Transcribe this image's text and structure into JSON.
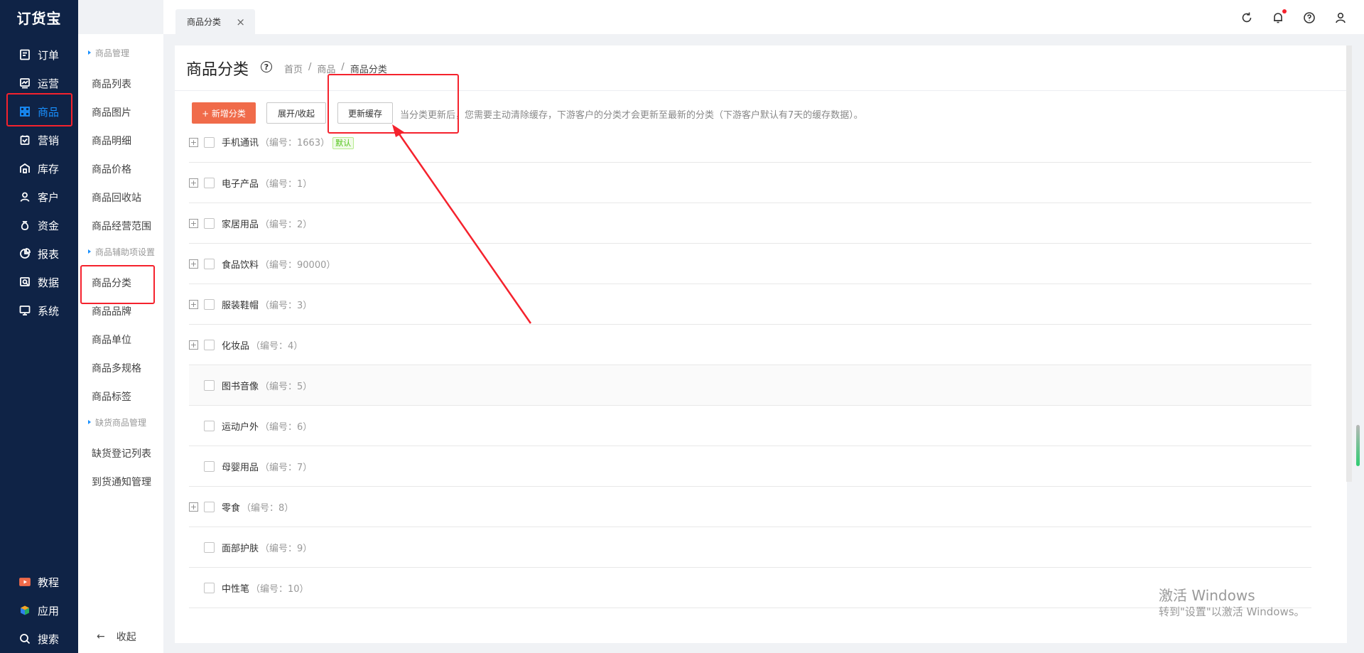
{
  "app": {
    "logo": "订货宝"
  },
  "nav": {
    "items": [
      {
        "label": "订单",
        "icon": "order-icon"
      },
      {
        "label": "运营",
        "icon": "operation-icon"
      },
      {
        "label": "商品",
        "icon": "product-icon",
        "active": true
      },
      {
        "label": "营销",
        "icon": "marketing-icon"
      },
      {
        "label": "库存",
        "icon": "warehouse-icon"
      },
      {
        "label": "客户",
        "icon": "user-icon"
      },
      {
        "label": "资金",
        "icon": "money-bag-icon"
      },
      {
        "label": "报表",
        "icon": "pie-chart-icon"
      },
      {
        "label": "数据",
        "icon": "data-icon"
      },
      {
        "label": "系统",
        "icon": "monitor-icon"
      }
    ],
    "bottom": [
      {
        "label": "教程",
        "icon": "video-icon"
      },
      {
        "label": "应用",
        "icon": "cube-icon"
      },
      {
        "label": "搜索",
        "icon": "search-icon"
      }
    ]
  },
  "submenu": {
    "group1": "商品管理",
    "group1_items": [
      "商品列表",
      "商品图片",
      "商品明细",
      "商品价格",
      "商品回收站",
      "商品经营范围"
    ],
    "group2": "商品辅助项设置",
    "group2_items": [
      "商品分类",
      "商品品牌",
      "商品单位",
      "商品多规格",
      "商品标签"
    ],
    "group3": "缺货商品管理",
    "group3_items": [
      "缺货登记列表",
      "到货通知管理"
    ],
    "collapse": "收起",
    "collapse_arrow": "←"
  },
  "tabs": [
    {
      "label": "商品分类",
      "close": "×"
    }
  ],
  "page": {
    "title": "商品分类",
    "help": "?",
    "breadcrumb": [
      "首页",
      "商品",
      "商品分类"
    ],
    "breadcrumb_sep": "/",
    "buttons": {
      "add": "+ 新增分类",
      "toggle": "展开/收起",
      "refresh": "更新缓存"
    },
    "hint": "当分类更新后，您需要主动清除缓存，下游客户的分类才会更新至最新的分类（下游客户默认有7天的缓存数据）。"
  },
  "categories": [
    {
      "name": "手机通讯",
      "code": "（编号：1663）",
      "tag": "默认",
      "expandable": true
    },
    {
      "name": "电子产品",
      "code": "（编号：1）",
      "expandable": true
    },
    {
      "name": "家居用品",
      "code": "（编号：2）",
      "expandable": true
    },
    {
      "name": "食品饮料",
      "code": "（编号：90000）",
      "expandable": true
    },
    {
      "name": "服装鞋帽",
      "code": "（编号：3）",
      "expandable": true
    },
    {
      "name": "化妆品",
      "code": "（编号：4）",
      "expandable": true
    },
    {
      "name": "图书音像",
      "code": "（编号：5）",
      "expandable": false
    },
    {
      "name": "运动户外",
      "code": "（编号：6）",
      "expandable": false
    },
    {
      "name": "母婴用品",
      "code": "（编号：7）",
      "expandable": false
    },
    {
      "name": "零食",
      "code": "（编号：8）",
      "expandable": true
    },
    {
      "name": "面部护肤",
      "code": "（编号：9）",
      "expandable": false
    },
    {
      "name": "中性笔",
      "code": "（编号：10）",
      "expandable": false
    }
  ],
  "expand_symbol": "+",
  "watermark": {
    "line1": "激活 Windows",
    "line2": "转到\"设置\"以激活 Windows。"
  },
  "colors": {
    "nav_bg": "#0f2346",
    "accent": "#1890ff",
    "primary_button": "#f06b4a",
    "annotation": "#f5222d"
  }
}
